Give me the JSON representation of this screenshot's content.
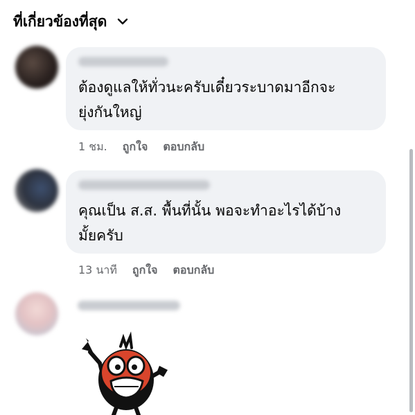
{
  "header": {
    "title": "ที่เกี่ยวข้องที่สุด",
    "chevron_icon": "chevron-down-icon"
  },
  "comments": [
    {
      "text_lines": [
        "ต้องดูแลให้ทั่วนะครับเดี๋ยวระบาดมาอีกจะ",
        "ยุ่งกันใหญ่"
      ],
      "time": "1 ชม.",
      "like_label": "ถูกใจ",
      "reply_label": "ตอบกลับ"
    },
    {
      "text_lines": [
        "คุณเป็น ส.ส. พื้นที่นั้น พอจะทำอะไรได้บ้าง",
        "มั้ยครับ"
      ],
      "time": "13 นาที",
      "like_label": "ถูกใจ",
      "reply_label": "ตอบกลับ"
    },
    {
      "sticker": "screaming-character-sticker"
    }
  ],
  "colors": {
    "bubble_bg": "#f0f2f5",
    "meta_text": "#65676b",
    "sticker_red": "#d9452c"
  }
}
